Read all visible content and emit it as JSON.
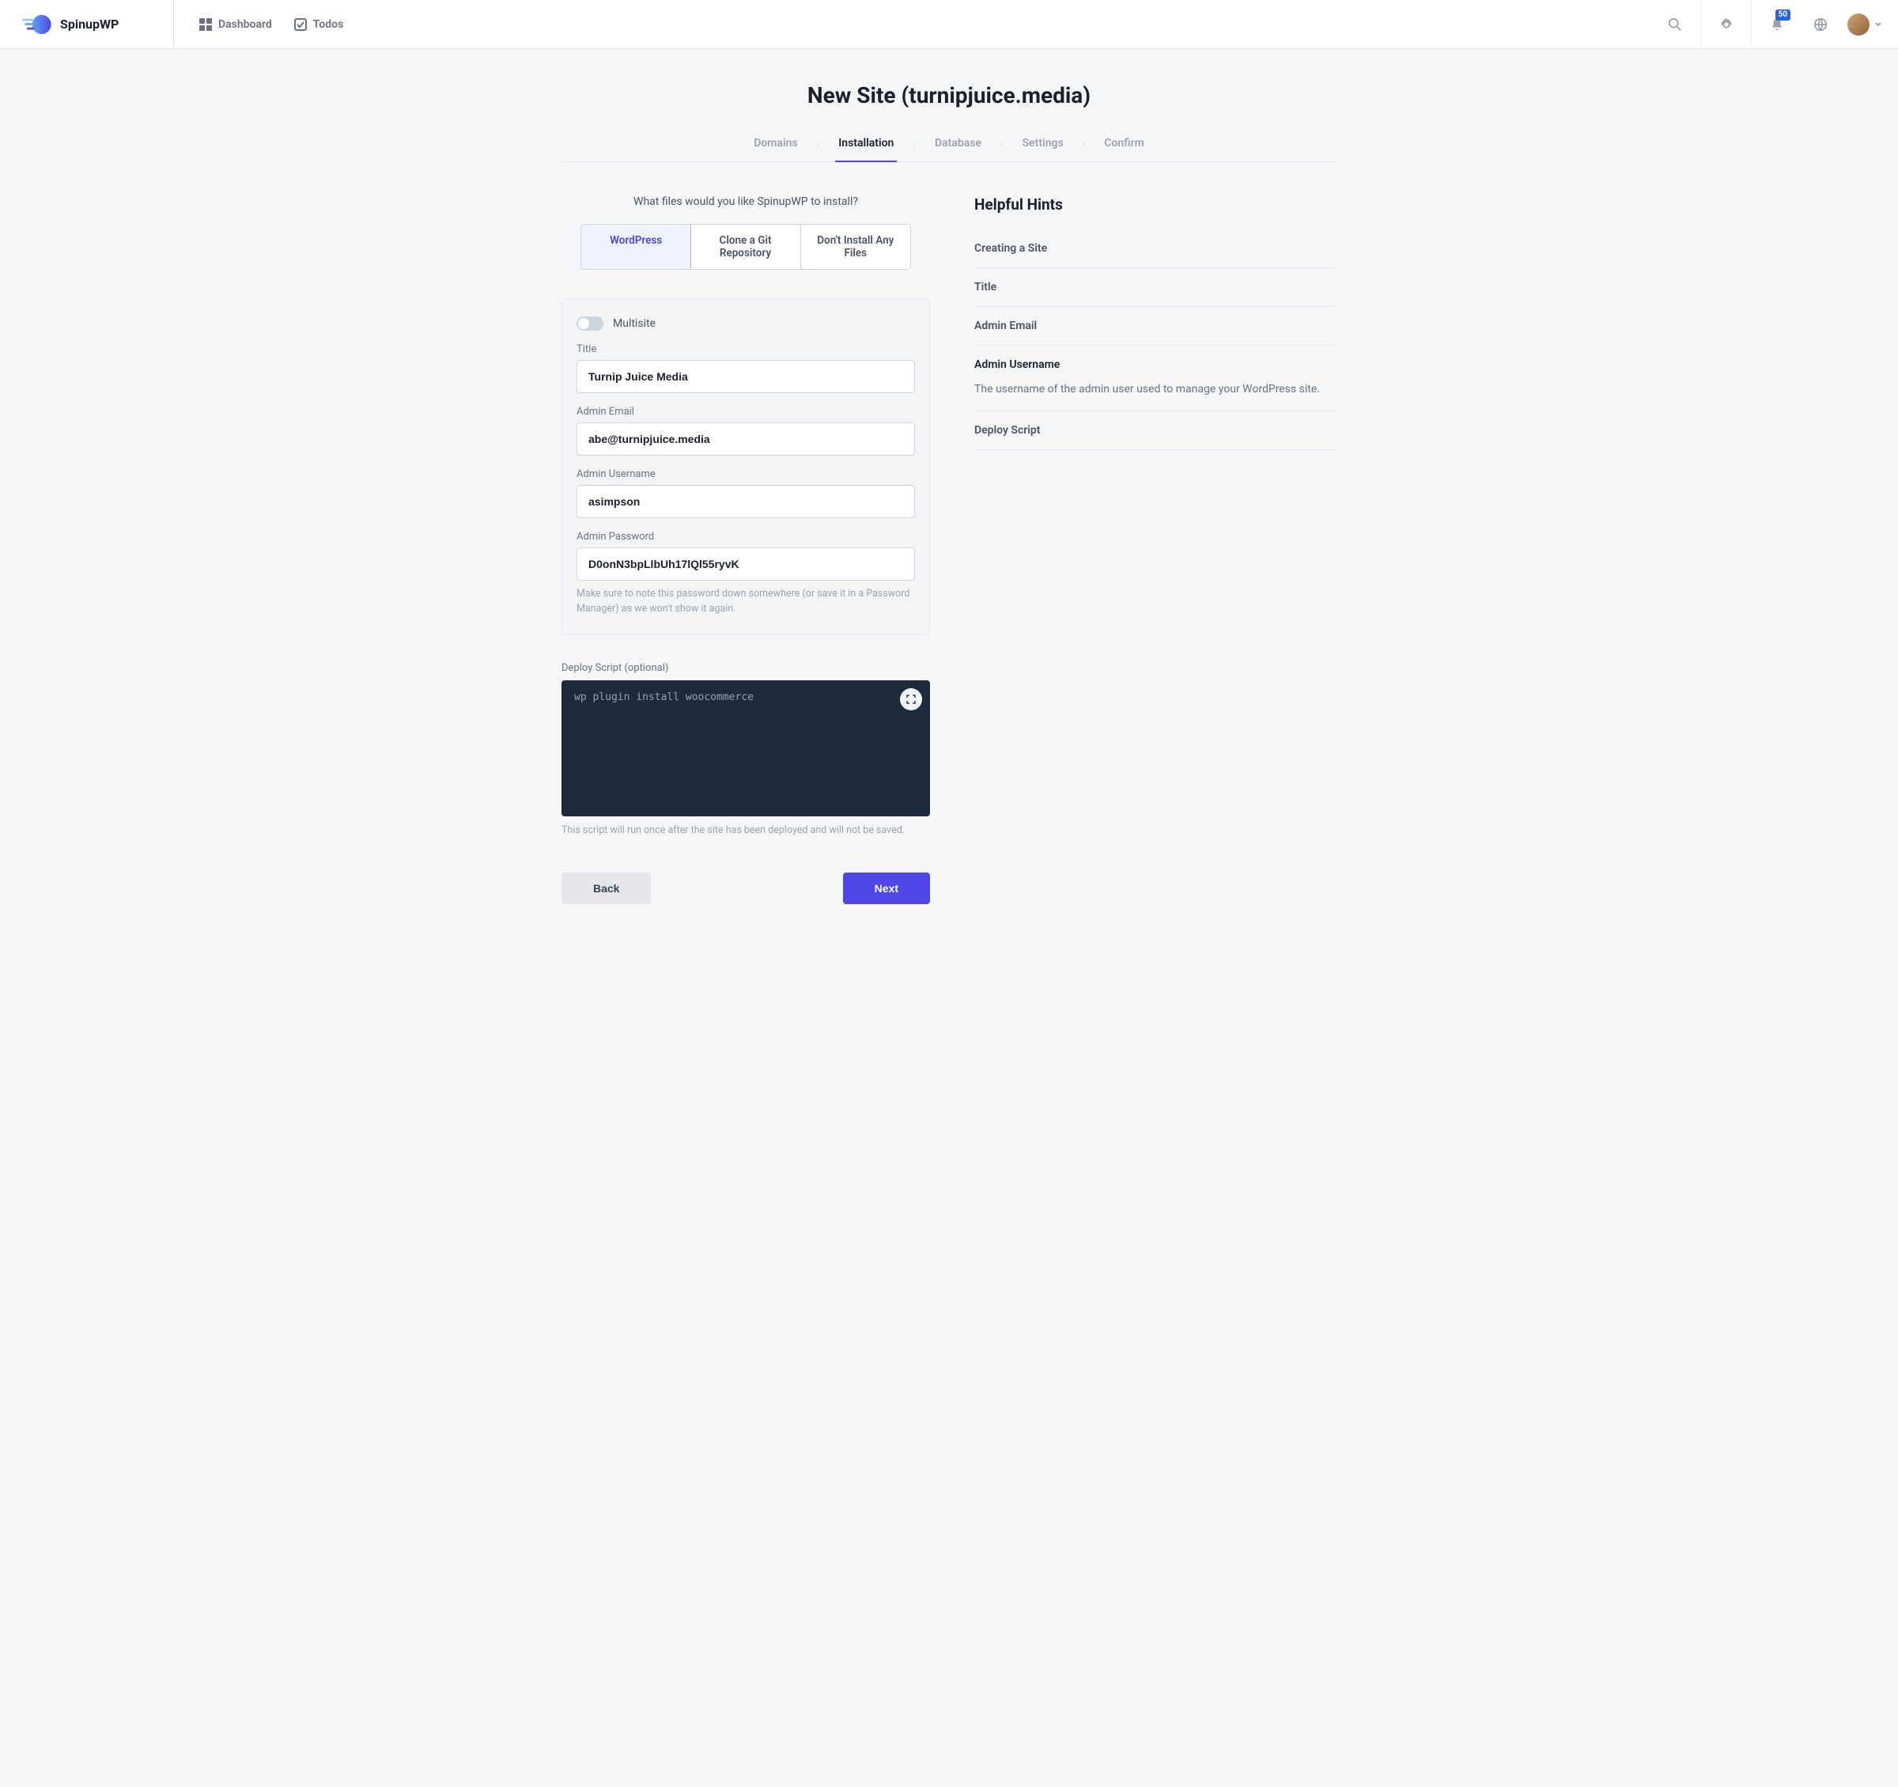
{
  "brand": {
    "name": "SpinupWP"
  },
  "nav": {
    "dashboard": "Dashboard",
    "todos": "Todos"
  },
  "notifications": {
    "count": "50"
  },
  "page_title": "New Site (turnipjuice.media)",
  "steps": {
    "domains": "Domains",
    "installation": "Installation",
    "database": "Database",
    "settings": "Settings",
    "confirm": "Confirm"
  },
  "prompt": "What files would you like SpinupWP to install?",
  "seg": {
    "wordpress": "WordPress",
    "git": "Clone a Git Repository",
    "none": "Don't Install Any Files"
  },
  "form": {
    "multisite_label": "Multisite",
    "title_label": "Title",
    "title_value": "Turnip Juice Media",
    "email_label": "Admin Email",
    "email_value": "abe@turnipjuice.media",
    "username_label": "Admin Username",
    "username_value": "asimpson",
    "password_label": "Admin Password",
    "password_value": "D0onN3bpLlbUh17lQl55ryvK",
    "password_hint": "Make sure to note this password down somewhere (or save it in a Password Manager) as we won't show it again."
  },
  "deploy": {
    "label": "Deploy Script (optional)",
    "placeholder": "wp plugin install woocommerce",
    "hint": "This script will run once after the site has been deployed and will not be saved."
  },
  "buttons": {
    "back": "Back",
    "next": "Next"
  },
  "hints": {
    "title": "Helpful Hints",
    "items": {
      "creating": "Creating a Site",
      "title_h": "Title",
      "email": "Admin Email",
      "username": "Admin Username",
      "username_body": "The username of the admin user used to manage your WordPress site.",
      "deploy": "Deploy Script"
    }
  }
}
